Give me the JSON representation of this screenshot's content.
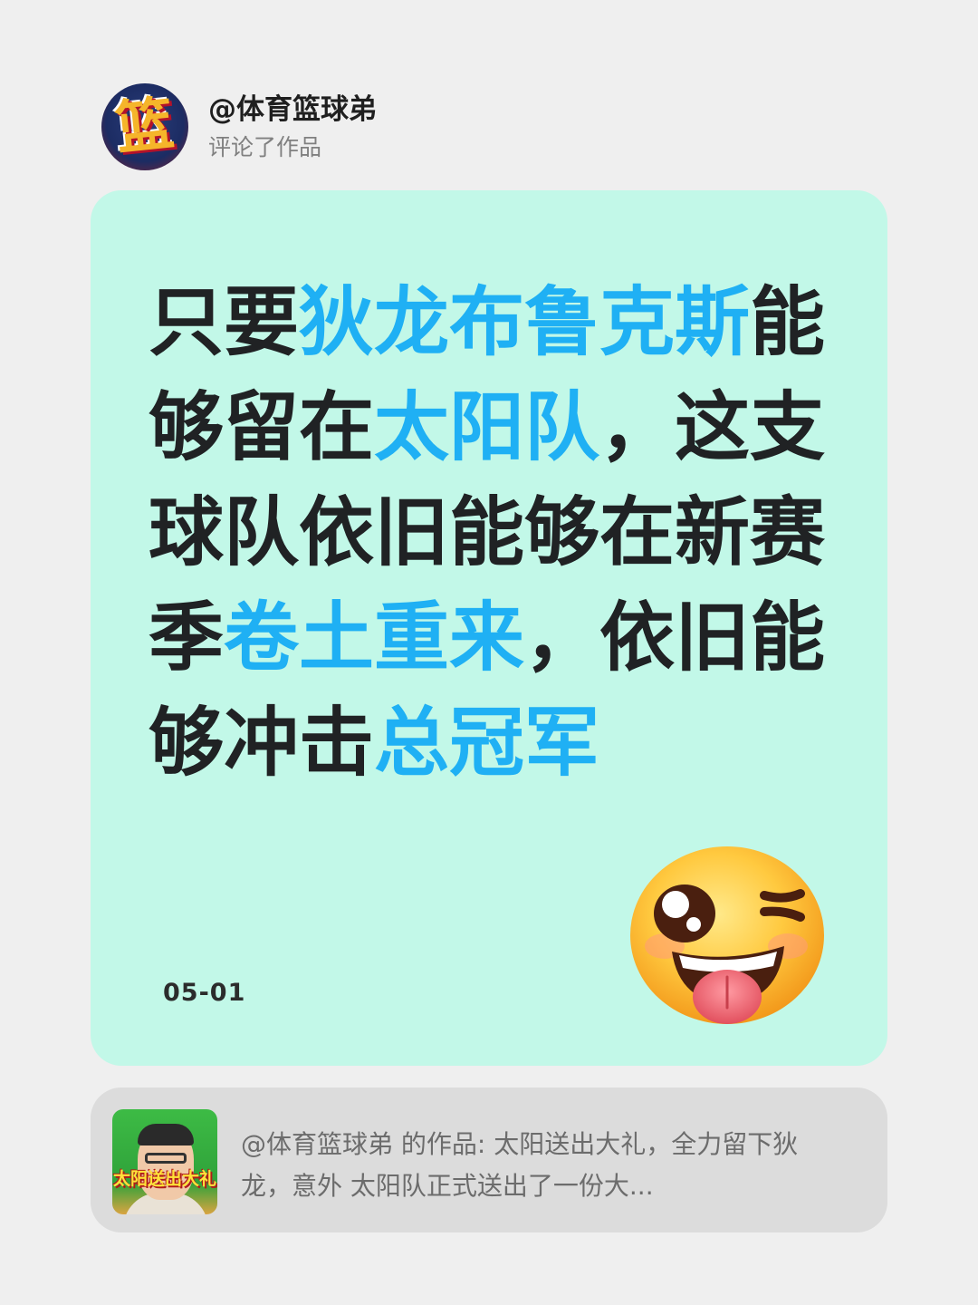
{
  "header": {
    "avatar_glyph": "篮",
    "username": "@体育篮球弟",
    "action": "评论了作品"
  },
  "comment": {
    "segments": [
      {
        "text": "只要",
        "highlight": false
      },
      {
        "text": "狄龙布鲁克斯",
        "highlight": true
      },
      {
        "text": "能够留在",
        "highlight": false
      },
      {
        "text": "太阳队",
        "highlight": true
      },
      {
        "text": "，这支球队依旧能够在新赛季",
        "highlight": false
      },
      {
        "text": "卷土重来",
        "highlight": true
      },
      {
        "text": "，依旧能够冲击",
        "highlight": false
      },
      {
        "text": "总冠军",
        "highlight": true
      }
    ],
    "date": "05-01",
    "emoji": "winking-tongue-emoji"
  },
  "colors": {
    "card_bg": "#c2f8e8",
    "highlight": "#1fb0f4",
    "text": "#202224",
    "page_bg": "#efefef"
  },
  "reference": {
    "thumbnail_caption": "太阳送出大礼",
    "text": "@体育篮球弟 的作品: 太阳送出大礼，全力留下狄龙，意外 太阳队正式送出了一份大..."
  }
}
